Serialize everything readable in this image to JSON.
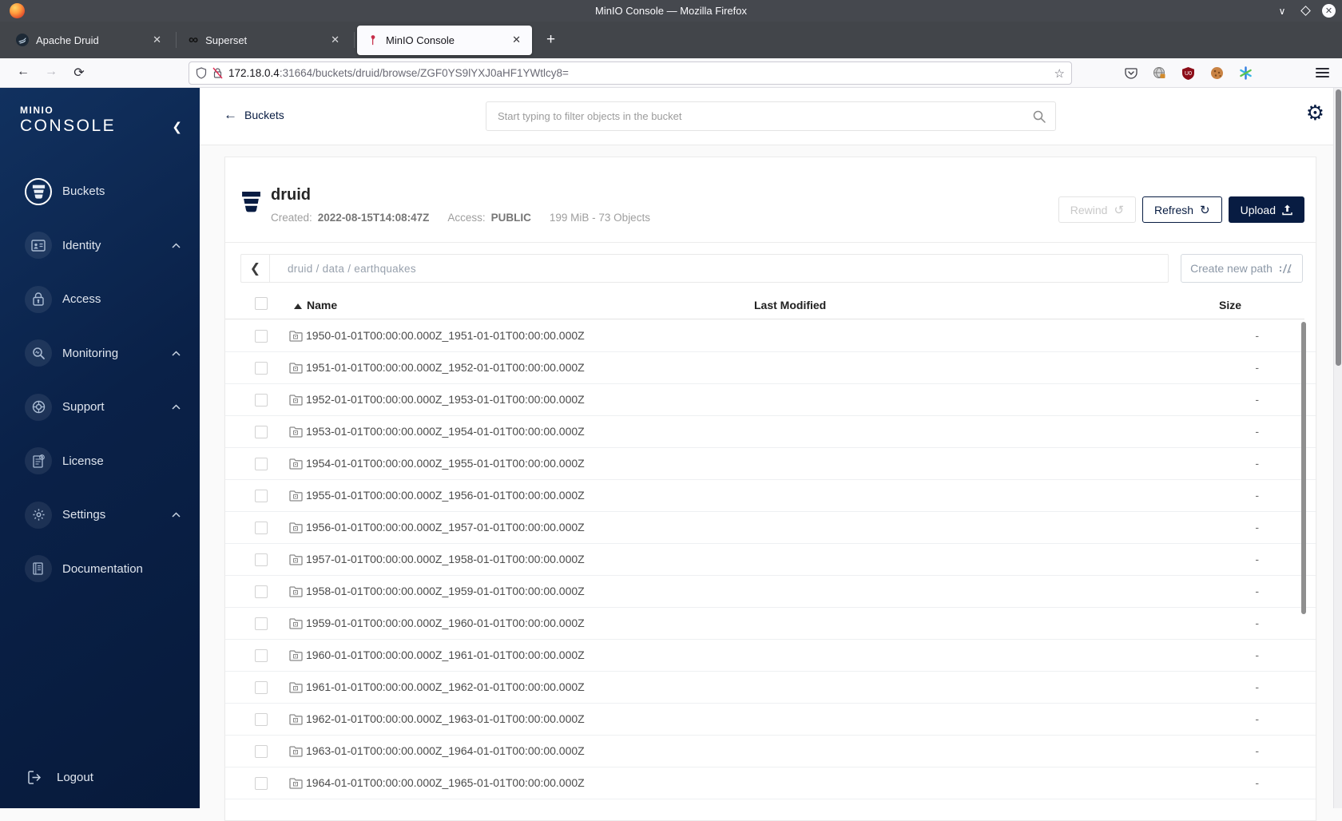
{
  "window": {
    "title": "MinIO Console — Mozilla Firefox"
  },
  "browser_tabs": [
    {
      "label": "Apache Druid"
    },
    {
      "label": "Superset"
    },
    {
      "label": "MinIO Console"
    }
  ],
  "urlbar": {
    "host": "172.18.0.4",
    "rest": ":31664/buckets/druid/browse/ZGF0YS9lYXJ0aHF1YWtlcy8="
  },
  "sidebar": {
    "logo_line1": "MINIO",
    "logo_line2": "CONSOLE",
    "items": [
      {
        "label": "Buckets"
      },
      {
        "label": "Identity"
      },
      {
        "label": "Access"
      },
      {
        "label": "Monitoring"
      },
      {
        "label": "Support"
      },
      {
        "label": "License"
      },
      {
        "label": "Settings"
      },
      {
        "label": "Documentation"
      }
    ],
    "logout": "Logout"
  },
  "header": {
    "back": "Buckets",
    "search_placeholder": "Start typing to filter objects in the bucket"
  },
  "bucket": {
    "name": "druid",
    "created_label": "Created:",
    "created_value": "2022-08-15T14:08:47Z",
    "access_label": "Access:",
    "access_value": "PUBLIC",
    "usage": "199 MiB - 73 Objects",
    "rewind_label": "Rewind",
    "refresh_label": "Refresh",
    "upload_label": "Upload"
  },
  "browse": {
    "path": "druid / data / earthquakes",
    "create_path_label": "Create new path"
  },
  "table": {
    "columns": {
      "name": "Name",
      "modified": "Last Modified",
      "size": "Size"
    },
    "rows": [
      {
        "name": "1950-01-01T00:00:00.000Z_1951-01-01T00:00:00.000Z",
        "size": "-"
      },
      {
        "name": "1951-01-01T00:00:00.000Z_1952-01-01T00:00:00.000Z",
        "size": "-"
      },
      {
        "name": "1952-01-01T00:00:00.000Z_1953-01-01T00:00:00.000Z",
        "size": "-"
      },
      {
        "name": "1953-01-01T00:00:00.000Z_1954-01-01T00:00:00.000Z",
        "size": "-"
      },
      {
        "name": "1954-01-01T00:00:00.000Z_1955-01-01T00:00:00.000Z",
        "size": "-"
      },
      {
        "name": "1955-01-01T00:00:00.000Z_1956-01-01T00:00:00.000Z",
        "size": "-"
      },
      {
        "name": "1956-01-01T00:00:00.000Z_1957-01-01T00:00:00.000Z",
        "size": "-"
      },
      {
        "name": "1957-01-01T00:00:00.000Z_1958-01-01T00:00:00.000Z",
        "size": "-"
      },
      {
        "name": "1958-01-01T00:00:00.000Z_1959-01-01T00:00:00.000Z",
        "size": "-"
      },
      {
        "name": "1959-01-01T00:00:00.000Z_1960-01-01T00:00:00.000Z",
        "size": "-"
      },
      {
        "name": "1960-01-01T00:00:00.000Z_1961-01-01T00:00:00.000Z",
        "size": "-"
      },
      {
        "name": "1961-01-01T00:00:00.000Z_1962-01-01T00:00:00.000Z",
        "size": "-"
      },
      {
        "name": "1962-01-01T00:00:00.000Z_1963-01-01T00:00:00.000Z",
        "size": "-"
      },
      {
        "name": "1963-01-01T00:00:00.000Z_1964-01-01T00:00:00.000Z",
        "size": "-"
      },
      {
        "name": "1964-01-01T00:00:00.000Z_1965-01-01T00:00:00.000Z",
        "size": "-"
      }
    ]
  },
  "colors": {
    "accent": "#081C42",
    "minio_red": "#C72E49"
  }
}
